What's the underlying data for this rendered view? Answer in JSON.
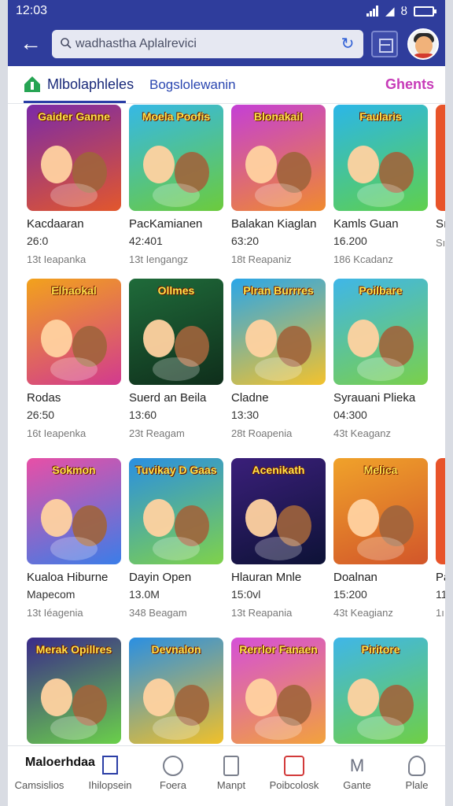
{
  "status": {
    "time": "12:03",
    "icons": [
      "signal-icon",
      "wifi-icon",
      "bluetooth-icon",
      "battery-icon"
    ]
  },
  "topbar": {
    "search_value": "wadhastha Aplalrevici",
    "tab_count_icon": "tabs-icon"
  },
  "tabs": [
    {
      "label": "Mlbolaphleles",
      "active": true
    },
    {
      "label": "Bogslolewanin",
      "active": false
    },
    {
      "label": "Ghents",
      "active": false
    }
  ],
  "games": [
    {
      "banner": "Gaider Ganne",
      "name": "Kacdaaran",
      "num": "26:0",
      "meta": "13t Ieapanka",
      "bg": [
        "#7b2aa8",
        "#e2572c"
      ]
    },
    {
      "banner": "Moela Poofis",
      "name": "PacKamianen",
      "num": "42:401",
      "meta": "13t Iengangz",
      "bg": [
        "#35b8e6",
        "#6ccb3c"
      ]
    },
    {
      "banner": "Blonakail",
      "name": "Balakan Kiaglan",
      "num": "63:20",
      "meta": "18t Reapaniz",
      "bg": [
        "#c43fd6",
        "#f08a2e"
      ]
    },
    {
      "banner": "Faularis",
      "name": "Kamls Guan",
      "num": "16.200",
      "meta": "186 Kcadanz",
      "bg": [
        "#2bb6e8",
        "#5fd04c"
      ]
    },
    {
      "banner": "Elhaokal",
      "name": "Rodas",
      "num": "26:50",
      "meta": "16t Ieapenka",
      "bg": [
        "#f2a21c",
        "#d23a8f"
      ]
    },
    {
      "banner": "Ollmes",
      "name": "Suerd an Beila",
      "num": "13:60",
      "meta": "23t Reagam",
      "bg": [
        "#1f6b3a",
        "#0f2e1b"
      ]
    },
    {
      "banner": "Plran Burrres",
      "name": "Cladne",
      "num": "13:30",
      "meta": "28t Roapenia",
      "bg": [
        "#2aa6e8",
        "#f3c22d"
      ]
    },
    {
      "banner": "Poilbare",
      "name": "Syrauani Plieka",
      "num": "04:300",
      "meta": "43t Keaganz",
      "bg": [
        "#3fb6e8",
        "#7ad04a"
      ]
    },
    {
      "banner": "Sokmon",
      "name": "Kualoa Hiburne",
      "num": "Mapecom",
      "meta": "13t Iéagenia",
      "bg": [
        "#e84fa6",
        "#3b7de8"
      ]
    },
    {
      "banner": "Tuvikay D Gaas",
      "name": "Dayin Open",
      "num": "13.0M",
      "meta": "348 Beagam",
      "bg": [
        "#2a8fe2",
        "#7fd24a"
      ]
    },
    {
      "banner": "Acenikath",
      "name": "Hlauran Mnle",
      "num": "15:0vl",
      "meta": "13t Reapania",
      "bg": [
        "#3a1f7a",
        "#0d1236"
      ]
    },
    {
      "banner": "Melica",
      "name": "Doalnan",
      "num": "15:200",
      "meta": "43t Keagianz",
      "bg": [
        "#f0a22a",
        "#d2562a"
      ]
    },
    {
      "banner": "Merak Opillres",
      "name": "",
      "num": "",
      "meta": "",
      "bg": [
        "#3a2a8a",
        "#6ad04a"
      ]
    },
    {
      "banner": "Devnalon",
      "name": "",
      "num": "",
      "meta": "",
      "bg": [
        "#2a8fe2",
        "#f0c02a"
      ]
    },
    {
      "banner": "Rerrlor Fanaen",
      "name": "",
      "num": "",
      "meta": "",
      "bg": [
        "#d54fd8",
        "#f2a23c"
      ]
    },
    {
      "banner": "Piritore",
      "name": "",
      "num": "",
      "meta": "",
      "bg": [
        "#3fb6e8",
        "#6fcf45"
      ]
    }
  ],
  "partial_column": [
    {
      "name": "Sı",
      "num": "",
      "meta": "Sı"
    },
    {
      "name": "",
      "num": "",
      "meta": ""
    },
    {
      "name": "Pa",
      "num": "11",
      "meta": "1ı"
    }
  ],
  "bottom_nav": {
    "brand": "Maloerhdaa",
    "items": [
      {
        "label": "Camsislios",
        "icon": "home-icon"
      },
      {
        "label": "Ihilopsein",
        "icon": "bookmark-icon"
      },
      {
        "label": "Foera",
        "icon": "gamepad-icon"
      },
      {
        "label": "Manpt",
        "icon": "store-icon"
      },
      {
        "label": "Poibcolosk",
        "icon": "notifications-icon"
      },
      {
        "label": "Gante",
        "icon": "games-icon"
      },
      {
        "label": "Plale",
        "icon": "profile-icon"
      }
    ]
  },
  "colors": {
    "header": "#2f3d9c",
    "accent": "#2b3ea6",
    "tab_highlight": "#c73bb8"
  }
}
